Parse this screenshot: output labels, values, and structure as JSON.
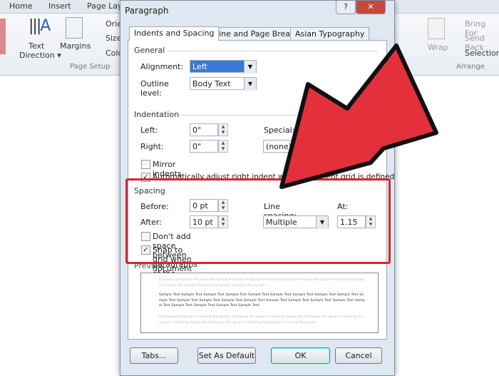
{
  "ribbon": {
    "tabs": [
      "Home",
      "Insert",
      "Page Layout"
    ],
    "text_direction": [
      "Text",
      "Direction ▾"
    ],
    "margins": "Margins",
    "orientation": "Orie",
    "size": "Size",
    "columns": "Colu",
    "page_setup": "Page Setup",
    "wrap": "Wrap",
    "bring_forward": "Bring For",
    "send_backward": "Send Back",
    "selection": "Selection",
    "arrange": "Arrange"
  },
  "dialog": {
    "title": "Paragraph",
    "help": "?",
    "close": "✕",
    "tabs": [
      "Indents and Spacing",
      "Line and Page Breaks",
      "Asian Typography"
    ],
    "general": {
      "heading": "General",
      "alignment_label": "Alignment:",
      "alignment_value": "Left",
      "outline_label": "Outline level:",
      "outline_value": "Body Text"
    },
    "indentation": {
      "heading": "Indentation",
      "left_label": "Left:",
      "left_value": "0\"",
      "right_label": "Right:",
      "right_value": "0\"",
      "special_label": "Special:",
      "special_value": "(none)",
      "mirror_label": "Mirror indents",
      "mirror_checked": false,
      "auto_label": "Automatically adjust right indent when document grid is defined",
      "auto_checked": true
    },
    "spacing": {
      "heading": "Spacing",
      "before_label": "Before:",
      "before_value": "0 pt",
      "after_label": "After:",
      "after_value": "10 pt",
      "line_spacing_label": "Line spacing:",
      "line_spacing_value": "Multiple",
      "at_label": "At:",
      "at_value": "1.15",
      "dont_add_label": "Don't add space between paragraphs of the same style",
      "dont_add_checked": false,
      "snap_label": "Snap to grid when document grid is defined",
      "snap_checked": true
    },
    "preview": {
      "heading": "Preview",
      "previous": "Previous Paragraph Previous Paragraph Previous Paragraph Previous Paragraph Previous Paragraph Previous Paragraph Previous Paragraph Previous Paragraph Previous Paragraph",
      "sample": "Sample Text Sample Text Sample Text Sample Text Sample Text Sample Text Sample Text Sample Text Sample Text Sample Text Sample Text Sample Text Sample Text Sample Text Sample Text Sample Text Sample Text Sample Text Sample Text Sample Text Sample Text Sample Text Sample Text",
      "following": "Following Paragraph Following Paragraph Following Paragraph Following Paragraph Following Paragraph Following Paragraph Following Paragraph Following Paragraph Following Paragraph Following Paragraph"
    },
    "buttons": {
      "tabs": "Tabs...",
      "set_default": "Set As Default",
      "ok": "OK",
      "cancel": "Cancel"
    }
  },
  "colors": {
    "highlight": "#d8262f",
    "arrow": "#e3303b"
  }
}
